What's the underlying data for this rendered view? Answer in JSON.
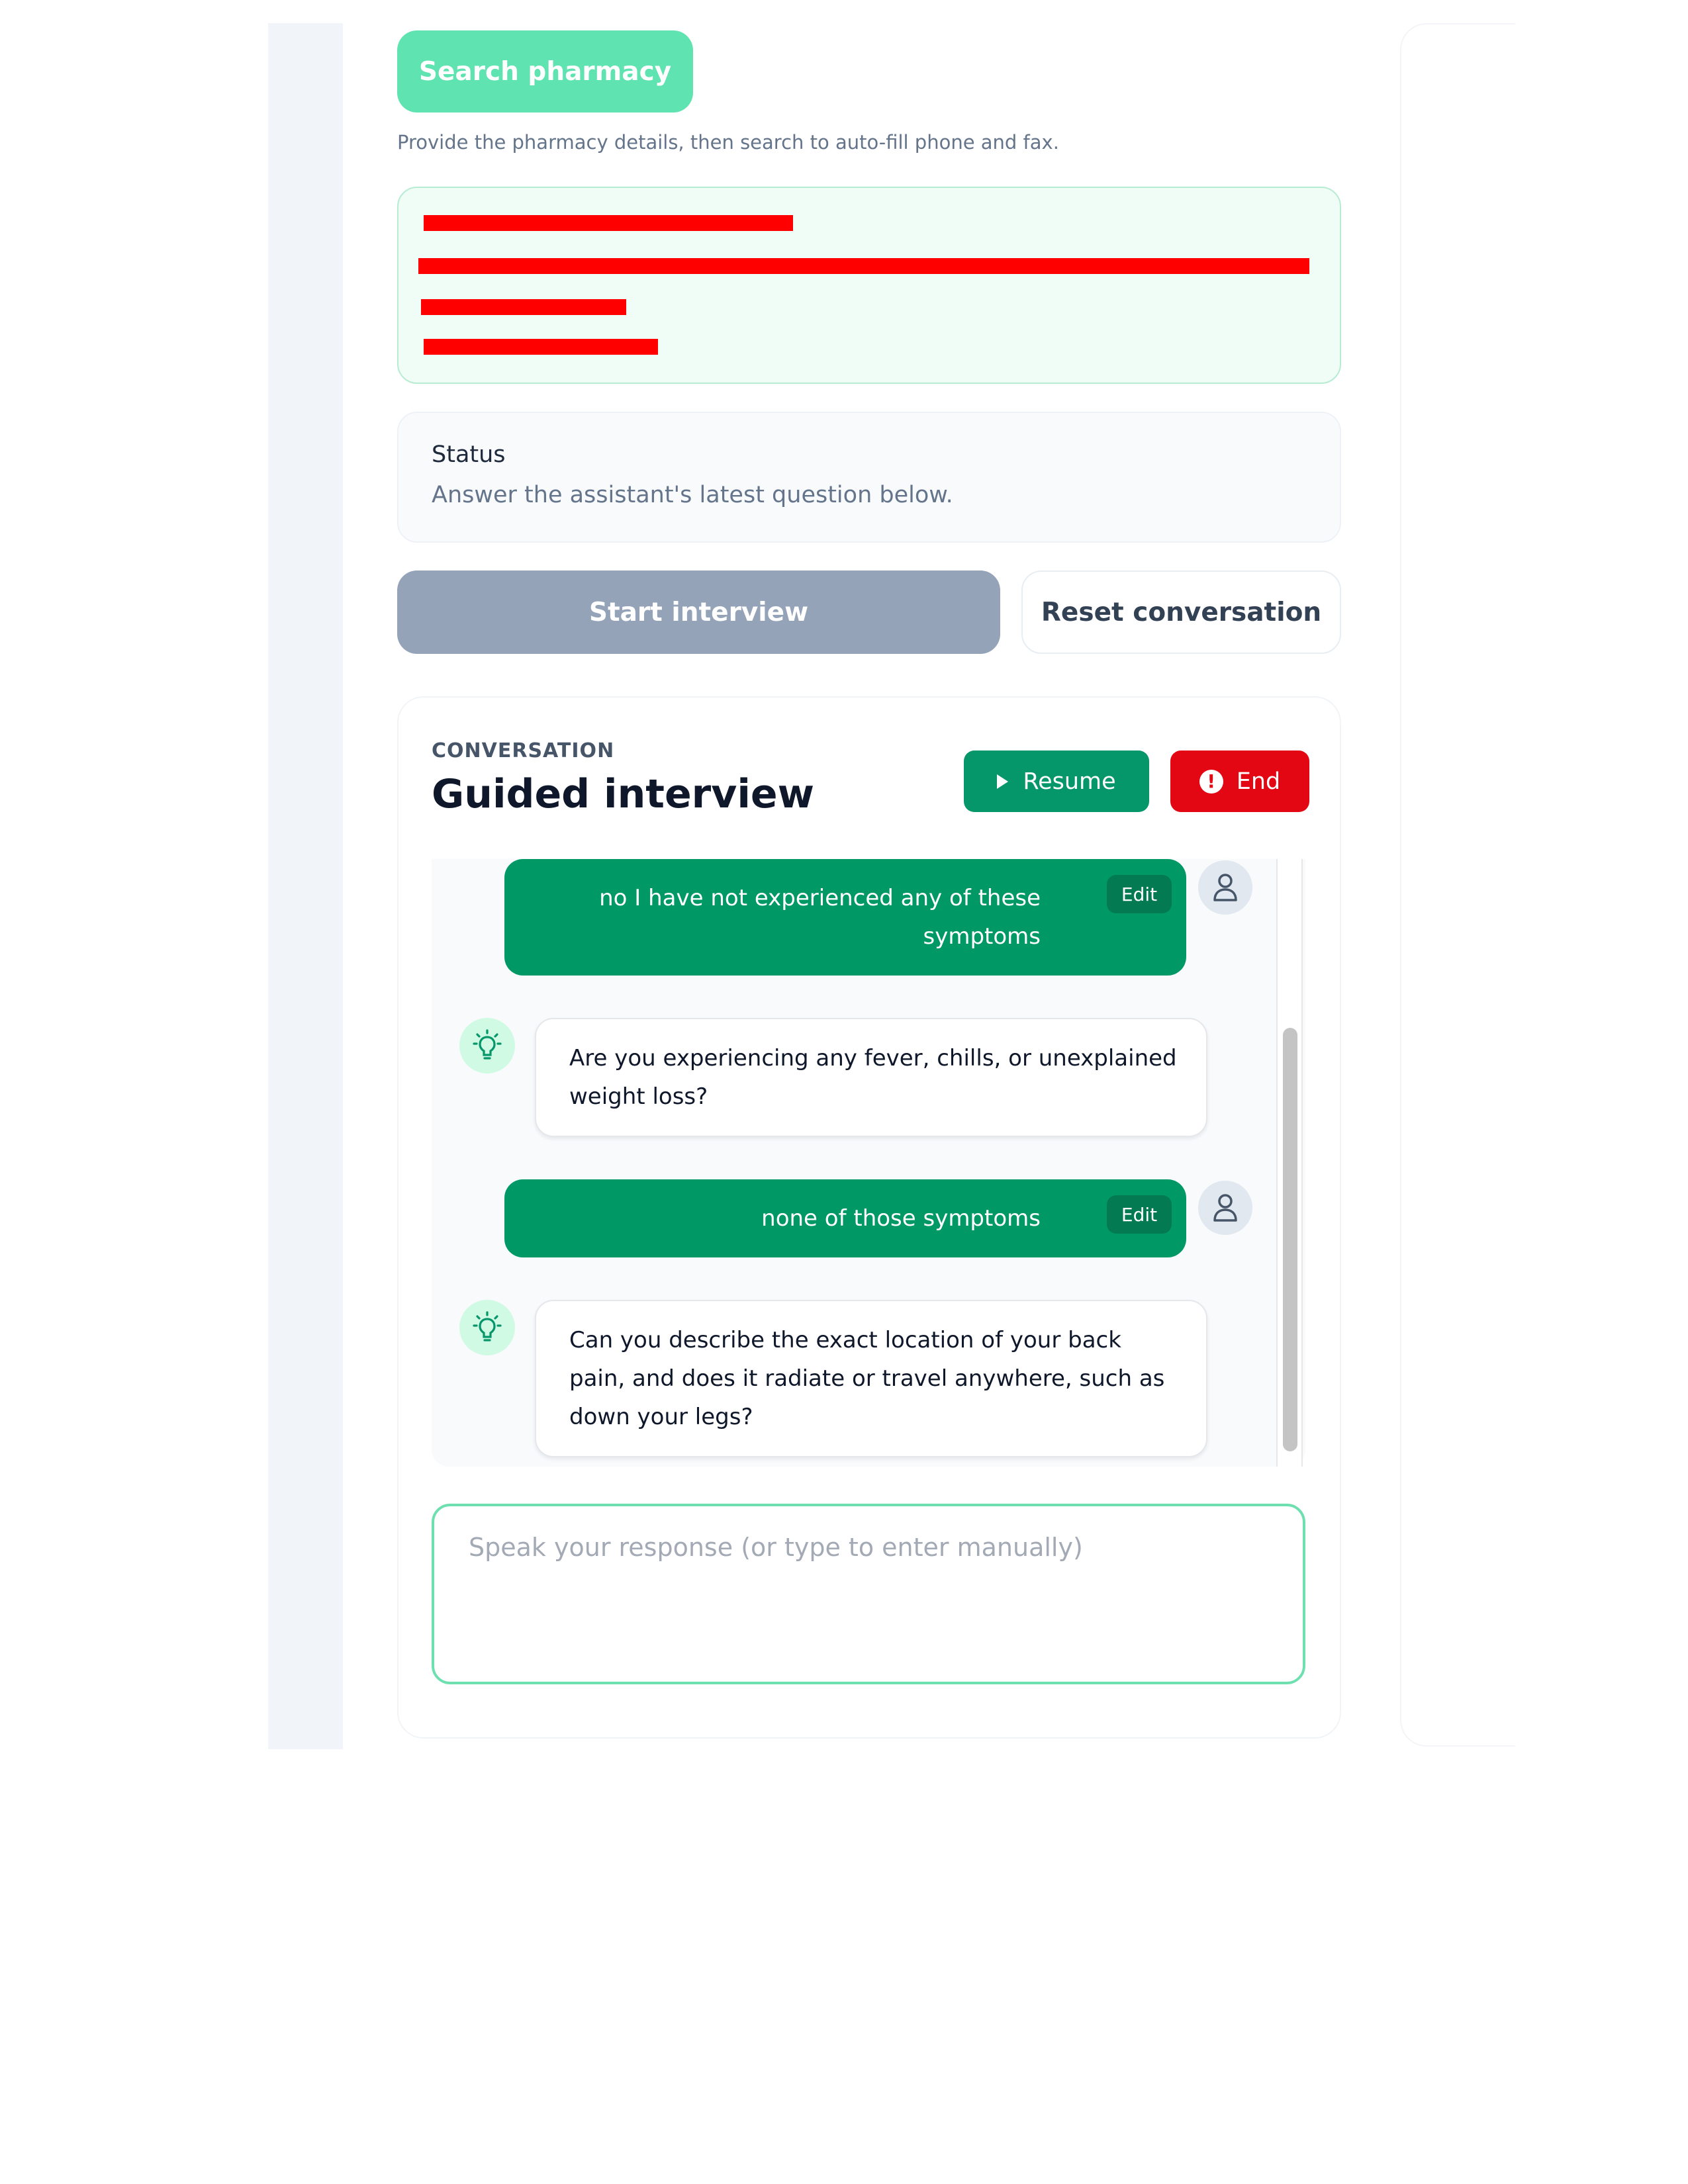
{
  "pharmacy": {
    "search_button": "Search pharmacy",
    "hint": "Provide the pharmacy details, then search to auto-fill phone and fax."
  },
  "status": {
    "title": "Status",
    "text": "Answer the assistant's latest question below."
  },
  "actions": {
    "start": "Start interview",
    "reset": "Reset conversation"
  },
  "conversation": {
    "eyebrow": "CONVERSATION",
    "title": "Guided interview",
    "resume": "Resume",
    "end": "End",
    "edit_label": "Edit",
    "messages": [
      {
        "role": "user",
        "text": "no I have not experienced any of these symptoms"
      },
      {
        "role": "assistant",
        "text": "Are you experiencing any fever, chills, or unexplained weight loss?"
      },
      {
        "role": "user",
        "text": "none of those symptoms"
      },
      {
        "role": "assistant",
        "text": "Can you describe the exact location of your back pain, and does it radiate or travel anywhere, such as down your legs?"
      }
    ]
  },
  "input": {
    "placeholder": "Speak your response (or type to enter manually)"
  },
  "colors": {
    "primary_green": "#059669",
    "danger_red": "#e30613",
    "search_green": "#5fe3b0",
    "disabled_gray": "#94a3b8"
  }
}
